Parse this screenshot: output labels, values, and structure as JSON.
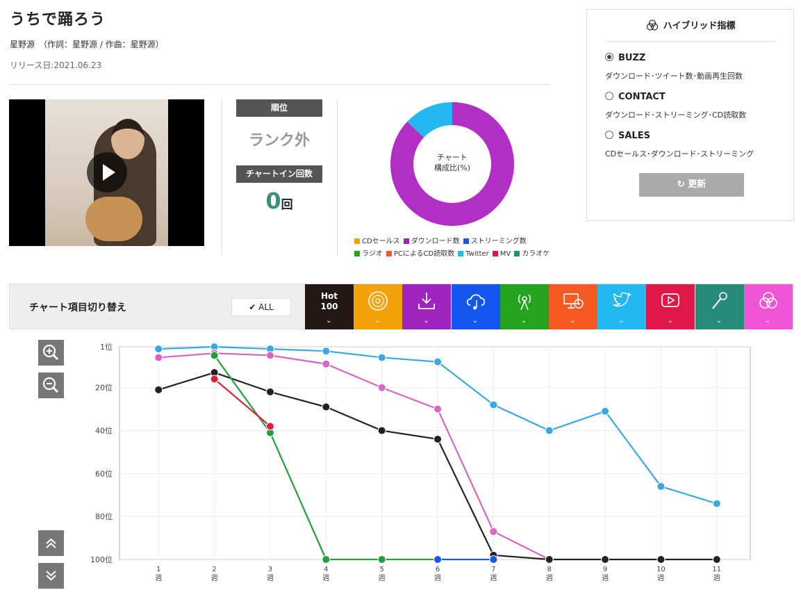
{
  "song": {
    "title": "うちで踊ろう",
    "artist_line": "星野源　（作詞：星野源 / 作曲：星野源）",
    "release": "リリース日:2021.06.23"
  },
  "rank": {
    "rank_label": "順位",
    "rank_value": "ランク外",
    "chartin_label": "チャートイン回数",
    "chartin_count": "0",
    "chartin_unit": "回"
  },
  "donut": {
    "center_line1": "チャート",
    "center_line2": "構成比(%)",
    "slices": [
      {
        "name": "ダウンロード数",
        "value": 87,
        "color": "#b22fc5"
      },
      {
        "name": "Twitter",
        "value": 13,
        "color": "#23b8f1"
      }
    ],
    "legend": [
      {
        "name": "CDセールス",
        "color": "#f4a20a"
      },
      {
        "name": "ダウンロード数",
        "color": "#9e24c0"
      },
      {
        "name": "ストリーミング数",
        "color": "#1556f0"
      },
      {
        "name": "ラジオ",
        "color": "#24a31e"
      },
      {
        "name": "PCによるCD読取数",
        "color": "#f55a22"
      },
      {
        "name": "Twitter",
        "color": "#23b8f1"
      },
      {
        "name": "MV",
        "color": "#e01848"
      },
      {
        "name": "カラオケ",
        "color": "#268c79"
      }
    ]
  },
  "hybrid": {
    "title": "ハイブリッド指標",
    "options": [
      {
        "label": "BUZZ",
        "desc": "ダウンロード･ツイート数･動画再生回数",
        "selected": true
      },
      {
        "label": "CONTACT",
        "desc": "ダウンロード･ストリーミング･CD読取数",
        "selected": false
      },
      {
        "label": "SALES",
        "desc": "CDセールス･ダウンロード･ストリーミング",
        "selected": false
      }
    ],
    "update_label": "更新"
  },
  "switcher": {
    "title": "チャート項目切り替え",
    "all_label": "ALL",
    "hot_label_1": "Hot",
    "hot_label_2": "100",
    "tabs": [
      {
        "name": "hot100",
        "color": "#231815",
        "icon": "hot100-icon"
      },
      {
        "name": "cd-sales",
        "color": "#f4a20a",
        "icon": "cd-icon"
      },
      {
        "name": "download",
        "color": "#9e24c0",
        "icon": "download-icon"
      },
      {
        "name": "streaming",
        "color": "#1556f0",
        "icon": "cloud-music-icon"
      },
      {
        "name": "radio",
        "color": "#24a31e",
        "icon": "radio-icon"
      },
      {
        "name": "pc-cd-read",
        "color": "#f55a22",
        "icon": "pc-cd-icon"
      },
      {
        "name": "twitter",
        "color": "#23b8f1",
        "icon": "twitter-icon"
      },
      {
        "name": "mv",
        "color": "#e01848",
        "icon": "play-video-icon"
      },
      {
        "name": "karaoke",
        "color": "#268c79",
        "icon": "microphone-icon"
      },
      {
        "name": "hybrid",
        "color": "#f055d8",
        "icon": "hybrid-icon"
      }
    ]
  },
  "chart_data": {
    "type": "line",
    "x": [
      1,
      2,
      3,
      4,
      5,
      6,
      7,
      8,
      9,
      10,
      11
    ],
    "xtick_labels": [
      "1\n週",
      "2\n週",
      "3\n週",
      "4\n週",
      "5\n週",
      "6\n週",
      "7\n週",
      "8\n週",
      "9\n週",
      "10\n週",
      "11\n週"
    ],
    "y_ticks": [
      1,
      20,
      40,
      60,
      80,
      100
    ],
    "ytick_labels": [
      "1位",
      "20位",
      "40位",
      "60位",
      "80位",
      "100位"
    ],
    "ylim": [
      1,
      100
    ],
    "y_inverted": true,
    "grid": true,
    "series": [
      {
        "color": "#3aa8e0",
        "x": [
          1,
          2,
          3,
          4,
          5,
          6,
          7,
          8,
          9,
          10,
          11
        ],
        "y": [
          2,
          1,
          2,
          3,
          6,
          8,
          28,
          40,
          31,
          66,
          74
        ]
      },
      {
        "color": "#d864c4",
        "x": [
          1,
          2,
          3,
          4,
          5,
          6,
          7,
          8
        ],
        "y": [
          6,
          4,
          5,
          9,
          20,
          30,
          87,
          100
        ]
      },
      {
        "color": "#222222",
        "x": [
          1,
          2,
          3,
          4,
          5,
          6,
          7,
          8,
          9,
          10,
          11
        ],
        "y": [
          21,
          13,
          22,
          29,
          40,
          44,
          98,
          100,
          100,
          100,
          100
        ]
      },
      {
        "color": "#1fa03a",
        "x": [
          2,
          3,
          4,
          5,
          6
        ],
        "y": [
          5,
          41,
          100,
          100,
          100
        ]
      },
      {
        "color": "#e0203a",
        "x": [
          2,
          3
        ],
        "y": [
          16,
          38
        ]
      },
      {
        "color": "#1556f0",
        "x": [
          6,
          7
        ],
        "y": [
          100,
          100
        ]
      }
    ]
  }
}
